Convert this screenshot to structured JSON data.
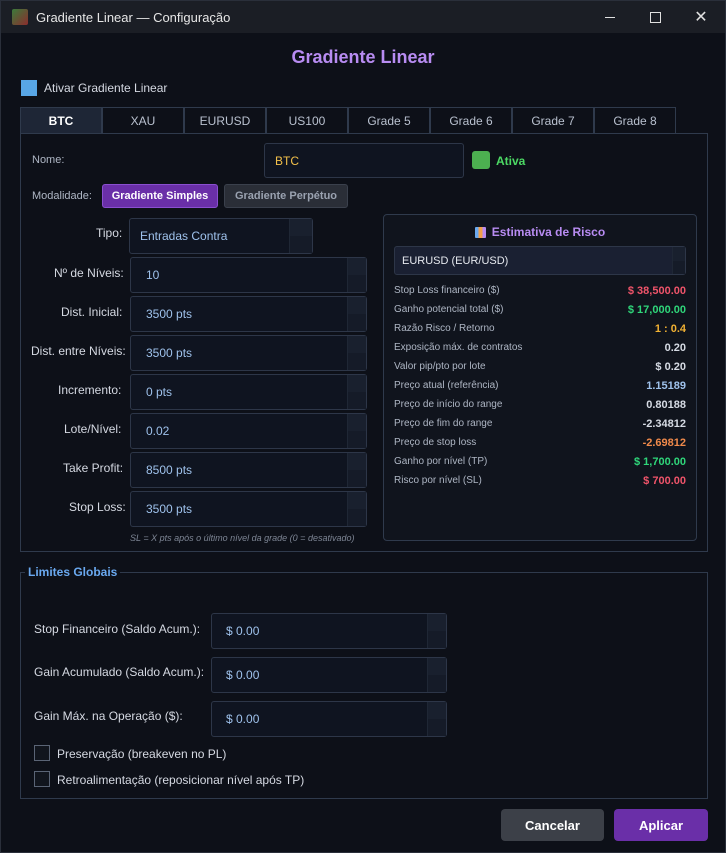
{
  "window": {
    "title": "Gradiente Linear — Configuração",
    "minimize_icon": "minimize-icon",
    "maximize_icon": "maximize-icon",
    "close_icon": "close-icon"
  },
  "heading": "Gradiente Linear",
  "enable": {
    "label": "Ativar Gradiente Linear",
    "checked": true
  },
  "tabs": [
    "BTC",
    "XAU",
    "EURUSD",
    "US100",
    "Grade 5",
    "Grade 6",
    "Grade 7",
    "Grade 8"
  ],
  "active_tab": "BTC",
  "form": {
    "name_label": "Nome:",
    "name_value": "BTC",
    "active_label": "Ativa",
    "mode_label": "Modalidade:",
    "mode_simple": "Gradiente Simples",
    "mode_perpetual": "Gradiente Perpétuo",
    "type_label": "Tipo:",
    "type_value": "Entradas Contra",
    "levels_label": "Nº de Níveis:",
    "levels_value": "10",
    "initial_dist_label": "Dist. Inicial:",
    "initial_dist_value": "3500 pts",
    "level_dist_label": "Dist. entre Níveis:",
    "level_dist_value": "3500 pts",
    "increment_label": "Incremento:",
    "increment_value": "0 pts",
    "lot_label": "Lote/Nível:",
    "lot_value": "0.02",
    "tp_label": "Take Profit:",
    "tp_value": "8500 pts",
    "sl_label": "Stop Loss:",
    "sl_value": "3500 pts",
    "sl_hint": "SL = X pts após o último nível da grade (0 = desativado)"
  },
  "risk": {
    "title": "Estimativa de Risco",
    "symbol": "EURUSD  (EUR/USD)",
    "rows": [
      {
        "k": "Stop Loss financeiro ($)",
        "v": "$ 38,500.00",
        "color": "#f0546a"
      },
      {
        "k": "Ganho potencial total ($)",
        "v": "$ 17,000.00",
        "color": "#2fd67a"
      },
      {
        "k": "Razão Risco / Retorno",
        "v": "1 : 0.4",
        "color": "#f2b233"
      },
      {
        "k": "Exposição máx. de contratos",
        "v": "0.20",
        "color": "#d6dbe4"
      },
      {
        "k": "Valor pip/pto por lote",
        "v": "$ 0.20",
        "color": "#d6dbe4"
      },
      {
        "k": "Preço atual (referência)",
        "v": "1.15189",
        "color": "#9fc2ec"
      },
      {
        "k": "Preço de início do range",
        "v": "0.80188",
        "color": "#d6dbe4"
      },
      {
        "k": "Preço de fim do range",
        "v": "-2.34812",
        "color": "#d6dbe4"
      },
      {
        "k": "Preço de stop loss",
        "v": "-2.69812",
        "color": "#f08a4b"
      },
      {
        "k": "Ganho por nível (TP)",
        "v": "$ 1,700.00",
        "color": "#2fd67a"
      },
      {
        "k": "Risco por nível (SL)",
        "v": "$ 700.00",
        "color": "#f0546a"
      }
    ]
  },
  "limits": {
    "title": "Limites Globais",
    "stop_fin_label": "Stop Financeiro (Saldo Acum.):",
    "stop_fin_value": "$ 0.00",
    "gain_acc_label": "Gain Acumulado (Saldo Acum.):",
    "gain_acc_value": "$ 0.00",
    "gain_max_label": "Gain Máx. na Operação ($):",
    "gain_max_value": "$ 0.00",
    "preserve_label": "Preservação (breakeven no PL)",
    "feedback_label": "Retroalimentação (reposicionar nível após TP)"
  },
  "buttons": {
    "cancel": "Cancelar",
    "apply": "Aplicar"
  }
}
